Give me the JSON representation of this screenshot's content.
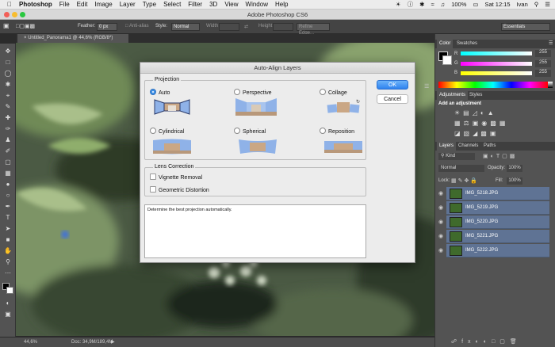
{
  "menubar": {
    "app": "Photoshop",
    "items": [
      "File",
      "Edit",
      "Image",
      "Layer",
      "Type",
      "Select",
      "Filter",
      "3D",
      "View",
      "Window",
      "Help"
    ],
    "battery": "100%",
    "clock": "Sat 12:15",
    "user": "Ivan"
  },
  "window": {
    "title": "Adobe Photoshop CS6"
  },
  "options": {
    "feather_label": "Feather:",
    "feather_value": "0 px",
    "antialias": "Anti-alias",
    "style_label": "Style:",
    "style_value": "Normal",
    "width_label": "Width:",
    "height_label": "Height:",
    "refine": "Refine Edge...",
    "workspace": "Essentials"
  },
  "document": {
    "tab": "Untitled_Panorama1 @ 44,6% (RGB/8*)",
    "zoom": "44,6%",
    "doc_info": "Doc: 34,9M/189,4M"
  },
  "panels": {
    "color_tabs": [
      "Color",
      "Swatches"
    ],
    "color_values": [
      "255",
      "255",
      "255"
    ],
    "adjust_tabs": [
      "Adjustments",
      "Styles"
    ],
    "adjust_title": "Add an adjustment",
    "layers_tabs": [
      "Layers",
      "Channels",
      "Paths"
    ],
    "kind": "Kind",
    "blend": "Normal",
    "opacity_label": "Opacity:",
    "opacity": "100%",
    "lock_label": "Lock:",
    "fill_label": "Fill:",
    "fill": "100%"
  },
  "layers": [
    "IMG_5218.JPG",
    "IMG_5219.JPG",
    "IMG_5220.JPG",
    "IMG_5221.JPG",
    "IMG_5222.JPG"
  ],
  "dialog": {
    "title": "Auto-Align Layers",
    "projection_label": "Projection",
    "options": [
      "Auto",
      "Perspective",
      "Collage",
      "Cylindrical",
      "Spherical",
      "Reposition"
    ],
    "lens_label": "Lens Correction",
    "vignette": "Vignette Removal",
    "geometric": "Geometric Distortion",
    "ok": "OK",
    "cancel": "Cancel",
    "description": "Determine the best projection automatically."
  },
  "colors": {
    "accent": "#3a8ee6",
    "layer_selected": "#5f7394",
    "panel_bg": "#535353"
  }
}
